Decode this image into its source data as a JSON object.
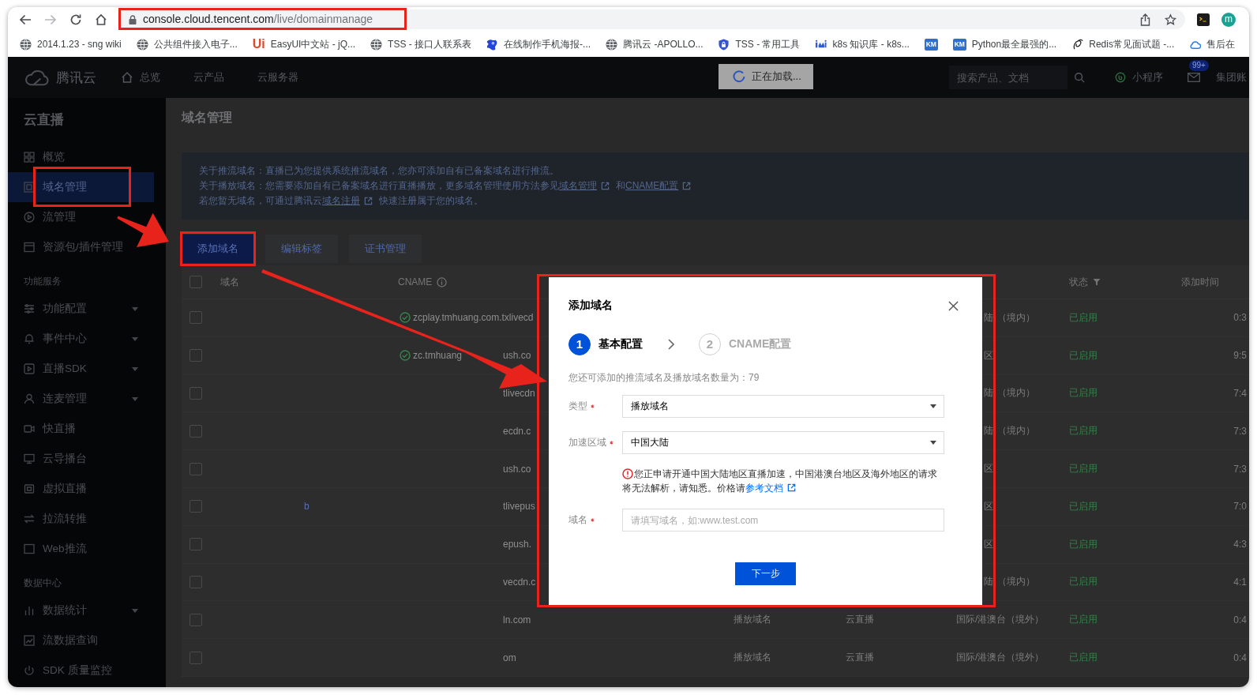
{
  "browser": {
    "nav_buttons": [
      {
        "kind": "back",
        "disabled": false
      },
      {
        "kind": "forward",
        "disabled": true
      },
      {
        "kind": "reload",
        "disabled": false
      },
      {
        "kind": "home",
        "disabled": false
      }
    ],
    "address": {
      "host": "console.cloud.tencent.com",
      "path": "/live/domainmanage"
    },
    "profile": {
      "initial": "m"
    }
  },
  "bookmarks": [
    {
      "kind": "globe",
      "label": "2014.1.23 - sng wiki"
    },
    {
      "kind": "globe",
      "label": "公共组件接入电子..."
    },
    {
      "kind": "text_logo",
      "logo": "Ui",
      "label": "EasyUI中文站 - jQ..."
    },
    {
      "kind": "globe",
      "label": "TSS - 接口人联系表"
    },
    {
      "kind": "splash",
      "label": "在线制作手机海报-..."
    },
    {
      "kind": "globe",
      "label": "腾讯云 -APOLLO..."
    },
    {
      "kind": "shield",
      "label": "TSS - 常用工具"
    },
    {
      "kind": "wave",
      "label": "k8s 知识库 - k8s..."
    },
    {
      "kind": "tile_logo",
      "logo": "KM"
    },
    {
      "kind": "tile_logo",
      "logo": "KM",
      "label": "Python最全最强的..."
    },
    {
      "kind": "swirl",
      "label": "Redis常见面试题 -..."
    },
    {
      "kind": "cloud",
      "label": "售后在"
    }
  ],
  "top_nav": {
    "brand": "腾讯云",
    "links": [
      {
        "kind": "home",
        "label": "总览"
      },
      {
        "kind": "plain",
        "label": "云产品"
      },
      {
        "kind": "plain",
        "label": "云服务器"
      }
    ],
    "search": {
      "placeholder": "搜索产品、文档"
    },
    "mini_program": "小程序",
    "mail_badge": "99+",
    "account": "集团账"
  },
  "loading_toast": "正在加载...",
  "sidebar": {
    "title": "云直播",
    "groups": [
      {
        "items": [
          {
            "label": "概览",
            "kind": "link",
            "selected": false
          },
          {
            "label": "域名管理",
            "kind": "link",
            "selected": true
          },
          {
            "label": "流管理",
            "kind": "link",
            "selected": false
          },
          {
            "label": "资源包/插件管理",
            "kind": "link",
            "selected": false
          }
        ]
      },
      {
        "label": "功能服务",
        "items": [
          {
            "label": "功能配置",
            "kind": "submenu",
            "selected": false
          },
          {
            "label": "事件中心",
            "kind": "submenu",
            "selected": false
          },
          {
            "label": "直播SDK",
            "kind": "submenu",
            "selected": false
          },
          {
            "label": "连麦管理",
            "kind": "submenu",
            "selected": false
          },
          {
            "label": "快直播",
            "kind": "link",
            "selected": false
          },
          {
            "label": "云导播台",
            "kind": "link",
            "selected": false
          },
          {
            "label": "虚拟直播",
            "kind": "link",
            "selected": false
          },
          {
            "label": "拉流转推",
            "kind": "link",
            "selected": false
          },
          {
            "label": "Web推流",
            "kind": "link",
            "selected": false
          }
        ]
      },
      {
        "label": "数据中心",
        "items": [
          {
            "label": "数据统计",
            "kind": "submenu",
            "selected": false
          },
          {
            "label": "流数据查询",
            "kind": "link",
            "selected": false
          },
          {
            "label": "SDK 质量监控",
            "kind": "link",
            "selected": false
          }
        ]
      }
    ]
  },
  "page": {
    "title": "域名管理",
    "notice": [
      [
        {
          "text": "关于推流域名：直播已为您提供系统推流域名，您亦可添加自有已备案域名进行推流。"
        }
      ],
      [
        {
          "text": "关于播放域名：您需要添加自有已备案域名进行直播播放，更多域名管理使用方法参见"
        },
        {
          "link": "域名管理"
        },
        {
          "text": "和"
        },
        {
          "link": "CNAME配置"
        }
      ],
      [
        {
          "text": "若您暂无域名，可通过腾讯云"
        },
        {
          "link": "域名注册"
        },
        {
          "text": "快速注册属于您的域名。"
        }
      ]
    ],
    "actions": [
      {
        "kind": "primary",
        "label": "添加域名"
      },
      {
        "kind": "default",
        "label": "编辑标签"
      },
      {
        "kind": "default",
        "label": "证书管理"
      }
    ],
    "table": {
      "all_checked": false,
      "headers": {
        "domain": "域名",
        "cname": "CNAME",
        "status": "状态",
        "added_time": "添加时间"
      },
      "rows": [
        {
          "checked": false,
          "verified": true,
          "cname": "zcplay.tmhuang.com.txlivecd",
          "region": "陆",
          "region_tail": "（境内）",
          "status": "已启用",
          "added_time": "0:3"
        },
        {
          "checked": false,
          "verified": true,
          "cname": "zc.tmhuang",
          "cname_tail": "ush.co",
          "region": "区",
          "status": "已启用",
          "added_time": "9:5"
        },
        {
          "checked": false,
          "verified": false,
          "cname_tail": "tlivecdn",
          "region": "陆",
          "region_tail": "（境内）",
          "status": "已启用",
          "added_time": "7:4"
        },
        {
          "checked": false,
          "verified": false,
          "cname_tail": "ecdn.c",
          "region": "陆",
          "region_tail": "（境内）",
          "status": "已启用",
          "added_time": "7:3"
        },
        {
          "checked": false,
          "verified": false,
          "cname_tail": "ush.co",
          "region": "区",
          "status": "已启用",
          "added_time": "7:3"
        },
        {
          "checked": false,
          "verified": false,
          "domain": "b",
          "cname_tail": "tlivepus",
          "region": "区",
          "status": "已启用",
          "added_time": "7:0"
        },
        {
          "checked": false,
          "verified": false,
          "cname_tail": "epush.",
          "region": "区",
          "status": "已启用",
          "added_time": "4:3"
        },
        {
          "checked": false,
          "verified": false,
          "cname_tail": "vecdn.c",
          "region": "陆",
          "region_tail": "（境内）",
          "status": "已启用",
          "added_time": "4:1"
        },
        {
          "checked": false,
          "verified": false,
          "cname_tail": "ln.com",
          "type": "播放域名",
          "product": "云直播",
          "region": "国际/港澳台（境外）",
          "status": "已启用",
          "added_time": "0:4"
        },
        {
          "checked": false,
          "verified": false,
          "cname_tail": "om",
          "type": "播放域名",
          "product": "云直播",
          "region": "国际/港澳台（境外）",
          "status": "已启用",
          "added_time": "0:4"
        }
      ]
    }
  },
  "dialog": {
    "title": "添加域名",
    "steps": [
      {
        "number": "1",
        "label": "基本配置",
        "selected": true
      },
      {
        "number": "2",
        "label": "CNAME配置",
        "selected": false
      }
    ],
    "quota": "您还可添加的推流域名及播放域名数量为：79",
    "fields": [
      {
        "kind": "select",
        "label": "类型",
        "required": true,
        "value": "播放域名"
      },
      {
        "kind": "select",
        "label": "加速区域",
        "required": true,
        "value": "中国大陆"
      },
      {
        "kind": "notice",
        "text": "您正申请开通中国大陆地区直播加速，中国港澳台地区及海外地区的请求将无法解析，请知悉。价格请",
        "link": "参考文档"
      },
      {
        "kind": "input",
        "label": "域名",
        "required": true,
        "placeholder": "请填写域名，如:www.test.com"
      }
    ],
    "submit": "下一步"
  }
}
